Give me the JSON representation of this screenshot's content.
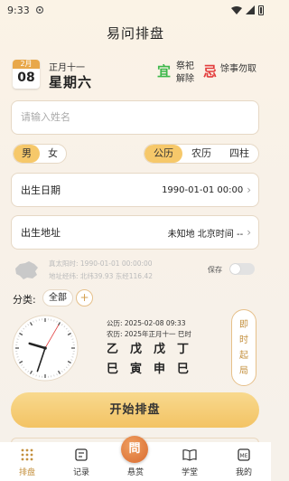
{
  "status": {
    "time": "9:33"
  },
  "app": {
    "title": "易问排盘"
  },
  "today": {
    "month": "2月",
    "day": "08",
    "lunar": "正月十一",
    "weekday": "星期六",
    "yi_char": "宜",
    "yi_items": "祭祀 解除",
    "ji_char": "忌",
    "ji_items": "馀事勿取"
  },
  "name_field": {
    "placeholder": "请输入姓名",
    "value": ""
  },
  "gender": {
    "options": [
      "男",
      "女"
    ],
    "selected": "男"
  },
  "calendar_type": {
    "options": [
      "公历",
      "农历",
      "四柱"
    ],
    "selected": "公历"
  },
  "birth_date": {
    "label": "出生日期",
    "value": "1990-01-01 00:00"
  },
  "birth_place": {
    "label": "出生地址",
    "value": "未知地 北京时间 --"
  },
  "location_info": {
    "solar_time": "真太阳时: 1990-01-01 00:00:00",
    "coords": "地址经纬: 北纬39.93 东经116.42",
    "save_label": "保存",
    "save_on": false
  },
  "category": {
    "label": "分类:",
    "selected": "全部",
    "add": "+"
  },
  "current": {
    "gregorian": "公历: 2025-02-08 09:33",
    "lunar": "农历: 2025年正月十一 巳时",
    "stems": [
      "乙",
      "戊",
      "戊",
      "丁"
    ],
    "branches": [
      "巳",
      "寅",
      "申",
      "巳"
    ],
    "clock": {
      "hour": 9,
      "minute": 33,
      "second": 5
    }
  },
  "instant_button": {
    "label": [
      "即",
      "时",
      "起",
      "局"
    ]
  },
  "start_button": {
    "label": "开始排盘"
  },
  "nav": {
    "items": [
      {
        "label": "排盘",
        "icon": "grid-icon"
      },
      {
        "label": "记录",
        "icon": "record-icon"
      },
      {
        "label": "悬赏",
        "icon": "reward-icon"
      },
      {
        "label": "学堂",
        "icon": "book-icon"
      },
      {
        "label": "我的",
        "icon": "profile-icon"
      }
    ],
    "active": "排盘",
    "center_char": "問"
  },
  "colors": {
    "accent": "#f3c364",
    "yi": "#3db84a",
    "ji": "#e33c3c",
    "brand_text": "#c4903e"
  }
}
